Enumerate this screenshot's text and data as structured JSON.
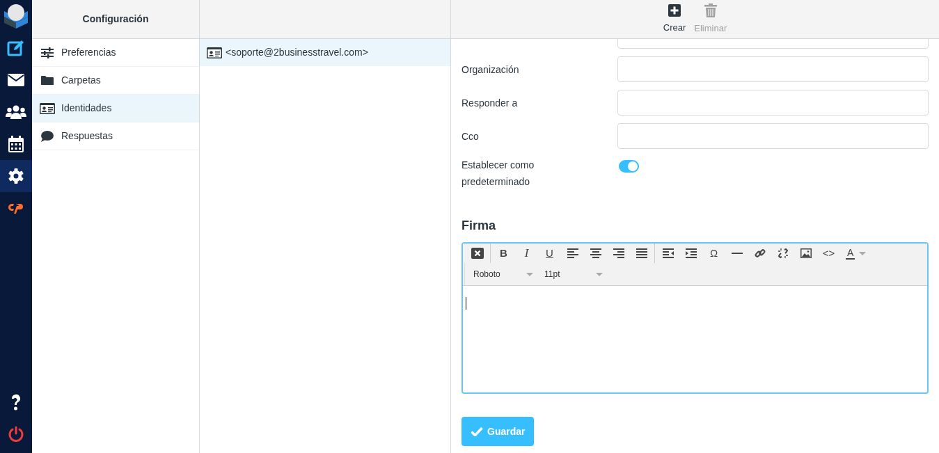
{
  "logo": {
    "kind": "logo"
  },
  "rail": [
    {
      "kind": "compose",
      "selected": false
    },
    {
      "kind": "mail",
      "selected": false
    },
    {
      "kind": "contacts",
      "selected": false
    },
    {
      "kind": "calendar",
      "selected": false
    },
    {
      "kind": "settings",
      "selected": true
    },
    {
      "kind": "cpanel",
      "selected": false
    }
  ],
  "rail_bottom": [
    {
      "kind": "help"
    },
    {
      "kind": "logout"
    }
  ],
  "settings": {
    "title": "Configuración",
    "items": [
      {
        "kind": "sliders",
        "label": "Preferencias",
        "selected": false
      },
      {
        "kind": "folder",
        "label": "Carpetas",
        "selected": false
      },
      {
        "kind": "idcard",
        "label": "Identidades",
        "selected": true
      },
      {
        "kind": "chat",
        "label": "Respuestas",
        "selected": false
      }
    ]
  },
  "identities": [
    {
      "label": "<soporte@2businesstravel.com>",
      "selected": true
    }
  ],
  "toolbar": [
    {
      "kind": "create",
      "label": "Crear",
      "disabled": false
    },
    {
      "kind": "delete",
      "label": "Eliminar",
      "disabled": true
    }
  ],
  "form": {
    "fields": [
      {
        "kind": "text",
        "label": "Organización"
      },
      {
        "kind": "text",
        "label": "Responder a"
      },
      {
        "kind": "text",
        "label": "Cco"
      },
      {
        "kind": "toggle",
        "label": "Establecer como predeterminado",
        "on": true
      }
    ],
    "signature_title": "Firma",
    "editor": {
      "buttons": [
        {
          "kind": "icon"
        },
        {
          "kind": "sep"
        },
        {
          "kind": "glyph",
          "text": "B"
        },
        {
          "kind": "glyph",
          "text": "I"
        },
        {
          "kind": "glyph",
          "text": "U"
        },
        {
          "kind": "icon"
        },
        {
          "kind": "icon"
        },
        {
          "kind": "icon"
        },
        {
          "kind": "icon"
        },
        {
          "kind": "sep"
        },
        {
          "kind": "icon"
        },
        {
          "kind": "icon"
        },
        {
          "kind": "glyph",
          "text": "Ω"
        },
        {
          "kind": "icon"
        },
        {
          "kind": "icon"
        },
        {
          "kind": "icon"
        },
        {
          "kind": "icon"
        },
        {
          "kind": "glyph",
          "text": "<>"
        },
        {
          "kind": "color",
          "text": "A"
        }
      ],
      "font": "Roboto",
      "size": "11pt"
    },
    "save": "Guardar"
  }
}
